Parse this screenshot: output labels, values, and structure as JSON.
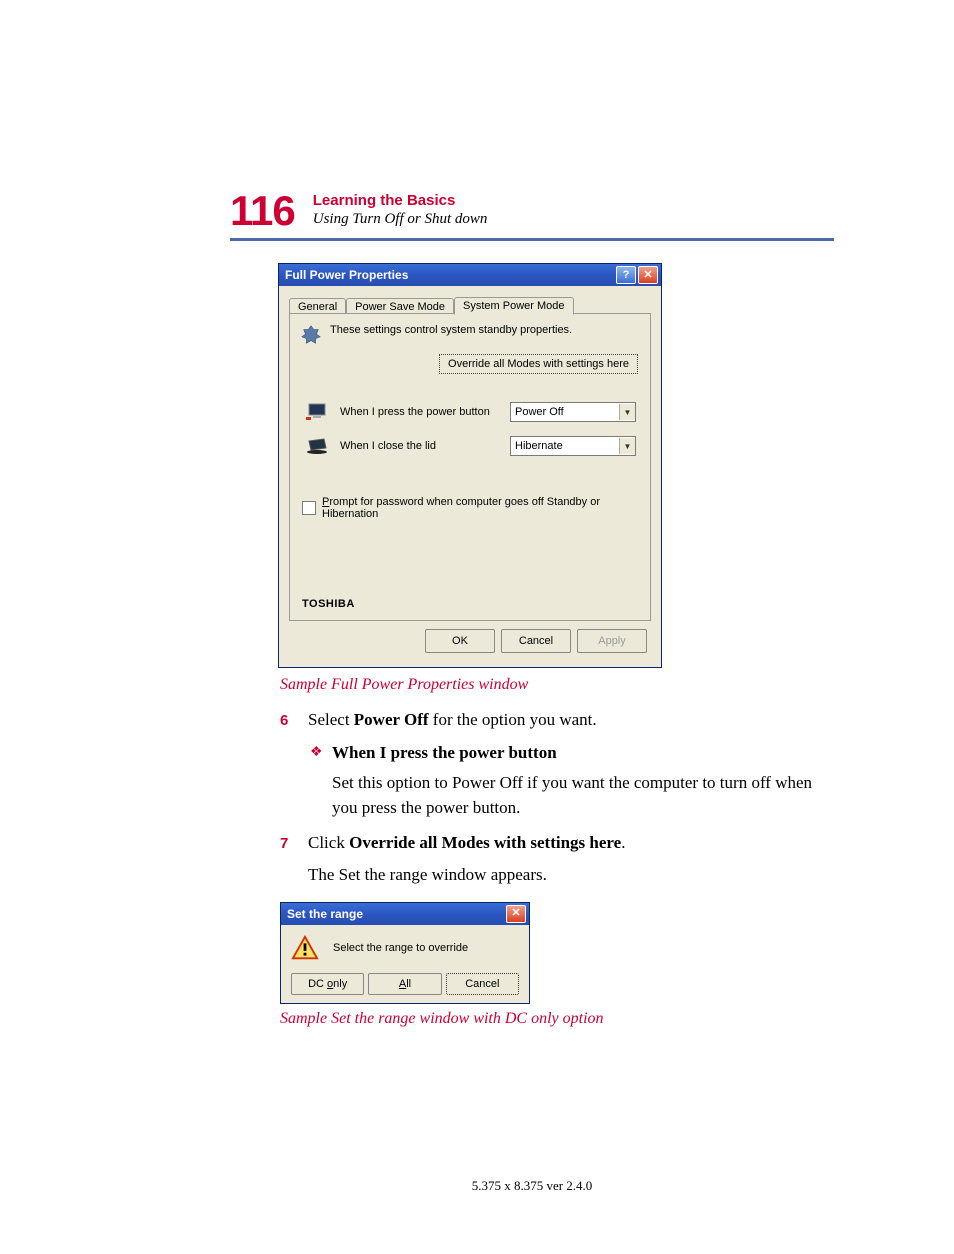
{
  "page_number": "116",
  "chapter": "Learning the Basics",
  "section": "Using Turn Off or Shut down",
  "caption1": "Sample Full Power Properties window",
  "step6": {
    "num": "6",
    "prefix": "Select ",
    "bold": "Power Off",
    "suffix": " for the option you want."
  },
  "bullet": {
    "label": "When I press the power button"
  },
  "bullet_body": "Set this option to Power Off if you want the computer to turn off when you press the power button.",
  "step7": {
    "num": "7",
    "prefix": "Click ",
    "bold": "Override all Modes with settings here",
    "suffix": "."
  },
  "after7": "The Set the range window appears.",
  "caption2": "Sample Set the range window with DC only option",
  "footer": "5.375 x 8.375 ver 2.4.0",
  "dialog1": {
    "title": "Full Power Properties",
    "tabs": {
      "general": "General",
      "powersave": "Power Save Mode",
      "systempower": "System Power Mode"
    },
    "desc": "These settings control system standby properties.",
    "override": "Override all Modes with settings here",
    "row1_label": "When I press the power button",
    "row1_value": "Power Off",
    "row2_label": "When I close the lid",
    "row2_value": "Hibernate",
    "prompt_check_prefix": "P",
    "prompt_check_rest": "rompt for password when computer goes off Standby or Hibernation",
    "brand": "TOSHIBA",
    "ok": "OK",
    "cancel": "Cancel",
    "apply": "Apply"
  },
  "dialog2": {
    "title": "Set the range",
    "msg": "Select the range to override",
    "dc_u": "o",
    "dc_pre": "DC ",
    "dc_post": "nly",
    "all_u": "A",
    "all_post": "ll",
    "cancel": "Cancel"
  }
}
